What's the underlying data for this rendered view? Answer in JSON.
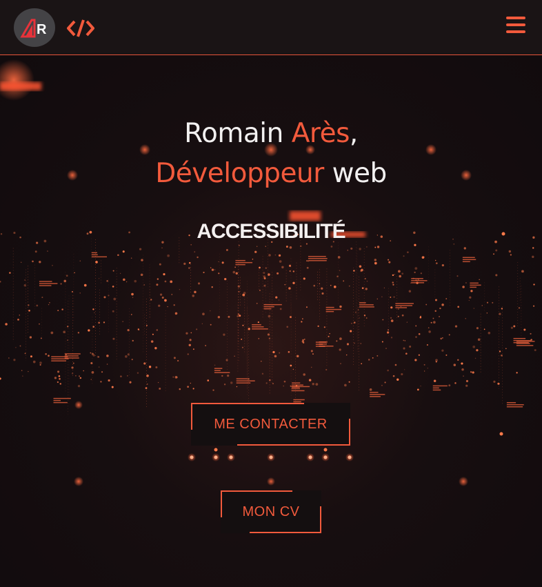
{
  "header": {
    "logo_alt": "AR",
    "logo_icon": "ar-logo-icon",
    "code_icon": "code-brackets-icon",
    "menu_icon": "hamburger-menu-icon"
  },
  "hero": {
    "name_first": "Romain",
    "name_last": "Arès",
    "comma": ",",
    "role_part1": "Développeur",
    "role_part2": "web",
    "subtitle": "ACCESSIBILITÉ"
  },
  "buttons": {
    "contact": "ME CONTACTER",
    "cv": "MON CV"
  },
  "colors": {
    "accent": "#f25a3c",
    "background": "#130d0f",
    "header": "#1a1415"
  }
}
